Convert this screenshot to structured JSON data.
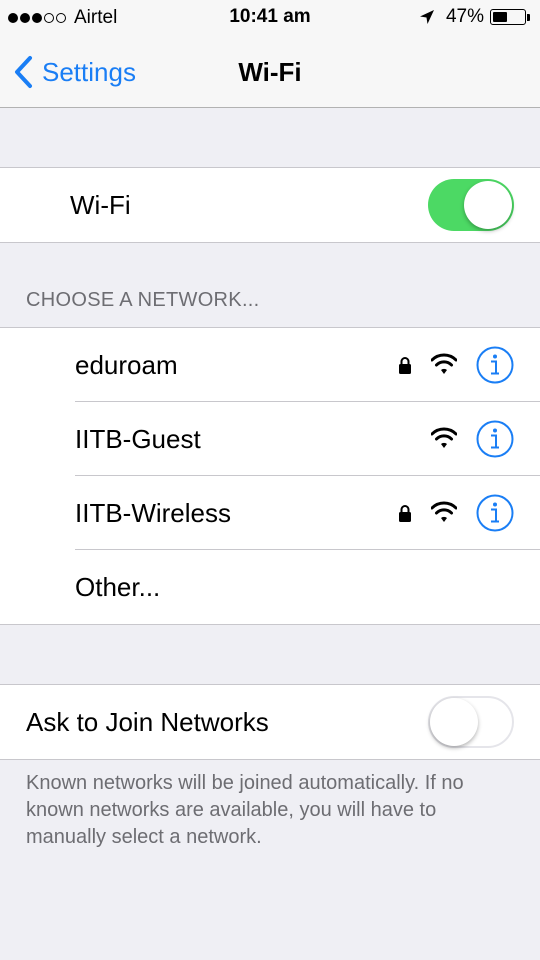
{
  "status_bar": {
    "carrier": "Airtel",
    "signal_bars_filled": 3,
    "signal_bars_total": 5,
    "time": "10:41 am",
    "battery_percent_label": "47%",
    "battery_level": 0.47
  },
  "nav": {
    "back_label": "Settings",
    "title": "Wi-Fi"
  },
  "wifi_toggle": {
    "label": "Wi-Fi",
    "on": true
  },
  "networks_section": {
    "header": "CHOOSE A NETWORK...",
    "networks": [
      {
        "name": "eduroam",
        "locked": true
      },
      {
        "name": "IITB-Guest",
        "locked": false
      },
      {
        "name": "IITB-Wireless",
        "locked": true
      }
    ],
    "other_label": "Other..."
  },
  "ask_to_join": {
    "label": "Ask to Join Networks",
    "on": false,
    "note": "Known networks will be joined automatically. If no known networks are available, you will have to manually select a network."
  },
  "colors": {
    "accent": "#1a7ef5",
    "switch_on": "#4cd964",
    "background": "#efeff4"
  },
  "icons": {
    "back": "chevron-left-icon",
    "location": "location-arrow-icon",
    "lock": "lock-icon",
    "wifi": "wifi-signal-icon",
    "info": "info-circle-icon"
  }
}
